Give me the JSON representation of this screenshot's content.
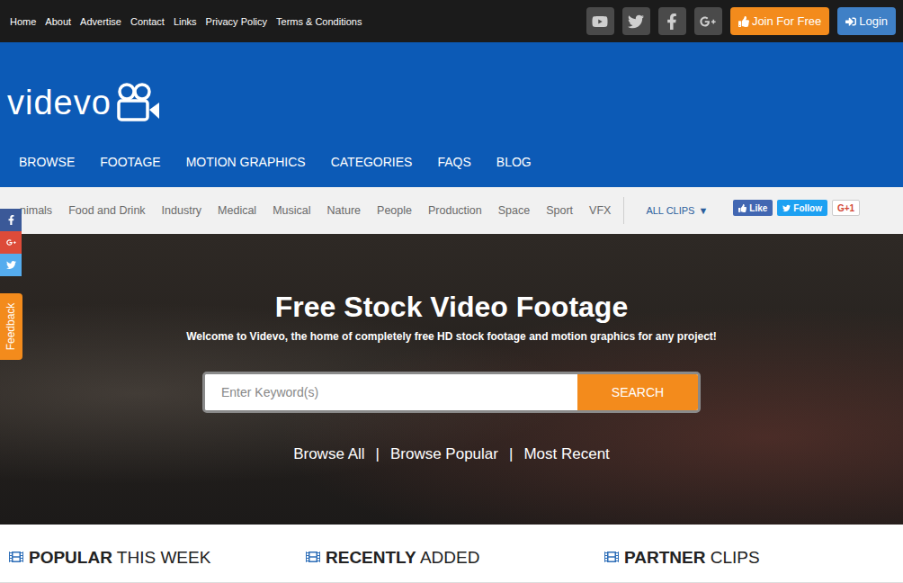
{
  "top_bar": {
    "links": [
      "Home",
      "About",
      "Advertise",
      "Contact",
      "Links",
      "Privacy Policy",
      "Terms & Conditions"
    ],
    "join_button": "Join For Free",
    "login_button": "Login"
  },
  "logo": {
    "text": "videvo"
  },
  "nav": [
    "BROWSE",
    "FOOTAGE",
    "MOTION GRAPHICS",
    "CATEGORIES",
    "FAQS",
    "BLOG"
  ],
  "categories": {
    "items": [
      "nimals",
      "Food and Drink",
      "Industry",
      "Medical",
      "Musical",
      "Nature",
      "People",
      "Production",
      "Space",
      "Sport",
      "VFX"
    ],
    "all_clips": "ALL CLIPS",
    "all_clips_arrow": "▼"
  },
  "social_buttons": {
    "like": "Like",
    "follow": "Follow",
    "plus_one": "G+1"
  },
  "hero": {
    "title": "Free Stock Video Footage",
    "subtitle": "Welcome to Videvo, the home of completely free HD stock footage and motion graphics for any project!",
    "search_placeholder": "Enter Keyword(s)",
    "search_button": "SEARCH",
    "separator": "|",
    "links": [
      "Browse All",
      "Browse Popular",
      "Most Recent"
    ]
  },
  "feedback": "Feedback",
  "sections": [
    {
      "bold": "POPULAR",
      "light": "THIS WEEK"
    },
    {
      "bold": "RECENTLY",
      "light": "ADDED"
    },
    {
      "bold": "PARTNER",
      "light": "CLIPS"
    }
  ]
}
